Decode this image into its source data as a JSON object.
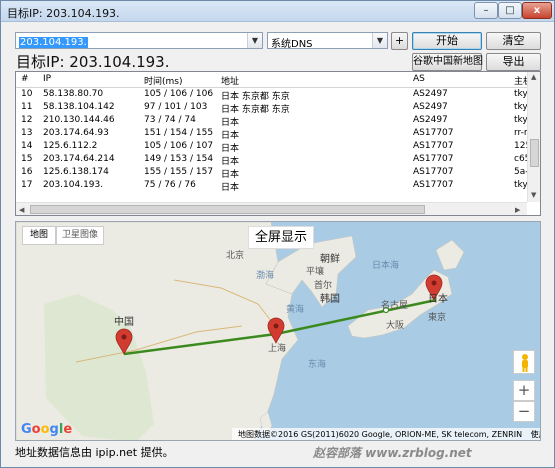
{
  "window": {
    "title": "目标IP: 203.104.193.",
    "min_label": "–",
    "max_label": "□",
    "close_label": "x"
  },
  "toolbar": {
    "target_value": "203.104.193.",
    "dns_value": "系统DNS",
    "plus_label": "+",
    "start_label": "开始",
    "clear_label": "清空",
    "google_map_label": "谷歌中国新地图",
    "export_label": "导出"
  },
  "target_header": {
    "text": "目标IP: 203.104.193."
  },
  "table": {
    "columns": [
      "#",
      "IP",
      "时间(ms)",
      "地址",
      "AS",
      "主机"
    ],
    "rows": [
      [
        "10",
        "58.138.80.70",
        "105 / 106 / 106",
        "日本 东京都 东京",
        "AS2497",
        "tkyO"
      ],
      [
        "11",
        "58.138.104.142",
        "97 / 101 / 103",
        "日本 东京都 东京",
        "AS2497",
        "tkyO"
      ],
      [
        "12",
        "210.130.144.46",
        "73 / 74 / 74",
        "日本",
        "AS2497",
        "tkyO"
      ],
      [
        "13",
        "203.174.64.93",
        "151 / 154 / 155",
        "日本",
        "AS17707",
        "rr-m"
      ],
      [
        "14",
        "125.6.112.2",
        "105 / 106 / 107",
        "日本",
        "AS17707",
        "125"
      ],
      [
        "15",
        "203.174.64.214",
        "149 / 153 / 154",
        "日本",
        "AS17707",
        "c65-"
      ],
      [
        "16",
        "125.6.138.174",
        "155 / 155 / 157",
        "日本",
        "AS17707",
        "5a-s"
      ],
      [
        "17",
        "203.104.193.",
        "75 / 76 / 76",
        "日本",
        "AS17707",
        "tkyO"
      ]
    ]
  },
  "map": {
    "tab_map": "地图",
    "tab_satellite": "卫星图像",
    "fullscreen_label": "全屏显示",
    "labels": {
      "china": "中国",
      "beijing": "北京",
      "bohai": "渤海",
      "north_korea": "朝鲜",
      "pyongyang": "平壤",
      "seoul": "首尔",
      "south_korea": "韩国",
      "yellow_sea": "黄海",
      "shanghai": "上海",
      "east_sea": "东海",
      "sea_of_japan": "日本海",
      "nagoya": "名古屋",
      "osaka": "大阪",
      "tokyo": "東京",
      "japan": "日本"
    },
    "google_logo": "Google",
    "attribution": "地图数据©2016 GS(2011)6020 Google, ORION-ME, SK telecom, ZENRIN",
    "terms": "使用条款",
    "zoom_in": "+",
    "zoom_out": "−",
    "route_color": "#3b8a1e",
    "marker_color": "#d23b30"
  },
  "footer": {
    "text": "地址数据信息由 ipip.net 提供。"
  },
  "watermark": {
    "text": "赵容部落 www.zrblog.net"
  }
}
